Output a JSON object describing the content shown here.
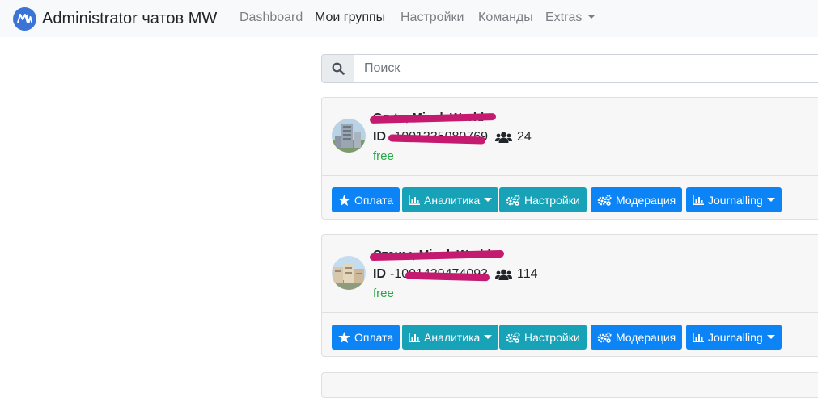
{
  "navbar": {
    "brand_title": "Administrator чатов MW",
    "links": [
      "Dashboard",
      "Мои группы",
      "Настройки",
      "Команды",
      "Extras"
    ],
    "active": "Мои группы"
  },
  "search": {
    "placeholder": "Поиск"
  },
  "buttons": {
    "payment": "Оплата",
    "analytics": "Аналитика",
    "settings": "Настройки",
    "moderation": "Модерация",
    "journalling": "Journalling"
  },
  "groups": [
    {
      "title": "Go-to, Minsk World",
      "id_label": "ID",
      "id_value": "-1001335080769",
      "members": "24",
      "plan": "free"
    },
    {
      "title": "Стены, Minsk World",
      "id_label": "ID",
      "id_value": "-1001439474093",
      "members": "114",
      "plan": "free"
    }
  ],
  "colors": {
    "primary": "#0d84f5",
    "info": "#17a2b8",
    "free": "#28a745",
    "brand_logo": "#3b74d6",
    "redaction": "#c41a6f"
  }
}
